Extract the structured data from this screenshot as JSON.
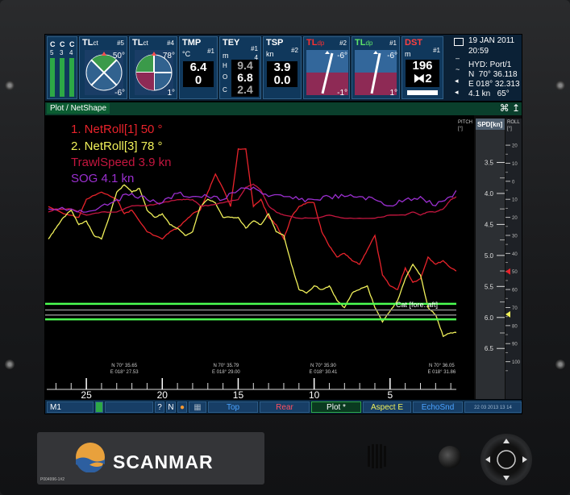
{
  "instruments": {
    "c_cols": [
      {
        "label": "C",
        "num": "5"
      },
      {
        "label": "C",
        "num": "3"
      },
      {
        "label": "C",
        "num": "4"
      }
    ],
    "tl1": {
      "title": "TL",
      "sub": "ct",
      "num": "#5",
      "val_top": "50°",
      "val_bot": "-6°"
    },
    "tl2": {
      "title": "TL",
      "sub": "ct",
      "num": "#4",
      "val_top": "78°",
      "val_bot": "1°"
    },
    "tmp": {
      "title": "TMP",
      "num": "#1",
      "unit": "°C",
      "val1": "6.4",
      "val2": "0"
    },
    "tey": {
      "title": "TEY",
      "num": "#1",
      "unit": "m",
      "sub_num": "4",
      "h": "9.4",
      "o": "6.8",
      "c": "2.4",
      "lh": "H",
      "lo": "O",
      "lc": "C"
    },
    "tsp": {
      "title": "TSP",
      "num": "#2",
      "unit": "kn",
      "val1": "3.9",
      "val2": "0.0"
    },
    "tldp1": {
      "title": "TL",
      "sub": "dp",
      "num": "#2",
      "val_top": "-6°",
      "val_bot": "-1°"
    },
    "tldp2": {
      "title": "TL",
      "sub": "dp",
      "num": "#1",
      "val_top": "-6°",
      "val_bot": "1°"
    },
    "dst": {
      "title": "DST",
      "num": "#1",
      "unit": "m",
      "val1": "196",
      "val2": "2"
    }
  },
  "info": {
    "date": "19 JAN 2011",
    "time": "20:59",
    "hyd": "HYD: Port/1",
    "lat_dir": "N",
    "lat": "70° 36.118",
    "lon_dir": "E",
    "lon": "018° 32.313",
    "spd": "4.1 kn",
    "hdg": "65°"
  },
  "plot": {
    "title": "Plot / NetShape",
    "tool_icons": [
      "⌘",
      "↥"
    ],
    "legend": [
      {
        "label": "1. NetRoll[1] 50 °",
        "color": "#e8232b"
      },
      {
        "label": "2. NetRoll[3] 78 °",
        "color": "#f0f05a"
      },
      {
        "label": "TrawlSpeed 3.9 kn",
        "color": "#c4163f"
      },
      {
        "label": "SOG 4.1 kn",
        "color": "#9b2fd0"
      }
    ],
    "cat_label": "Cat [fore..aft]",
    "pitch_label": "PITCH",
    "pitch_unit": "[°]",
    "spd_label": "SPD[kn]",
    "roll_label": "ROLL",
    "roll_unit": "[°]"
  },
  "chart_data": {
    "type": "line",
    "x_axis_ticks": [
      "25",
      "20",
      "15",
      "10",
      "5",
      "0"
    ],
    "x_ticks_values": [
      25,
      20,
      15,
      10,
      5,
      0
    ],
    "xlim": [
      27.5,
      0
    ],
    "positions": [
      {
        "lat": "N 70° 35.65",
        "lon": "E 018° 27.53",
        "x": 22.5
      },
      {
        "lat": "N 70° 35.79",
        "lon": "E 018° 29.00",
        "x": 15.8
      },
      {
        "lat": "N 70° 35.90",
        "lon": "E 018° 30.41",
        "x": 9.4
      },
      {
        "lat": "N 70° 36.05",
        "lon": "E 018° 31.86",
        "x": 1.6
      }
    ],
    "spd_scale": {
      "ticks": [
        "3.5",
        "4.0",
        "4.5",
        "5.0",
        "5.5",
        "6.0",
        "6.5"
      ],
      "values": [
        3.5,
        4.0,
        4.5,
        5.0,
        5.5,
        6.0,
        6.5
      ],
      "ylim": [
        3.0,
        6.9
      ]
    },
    "roll_scale": {
      "ticks": [
        "20",
        "10",
        "0",
        "10",
        "20",
        "30",
        "40",
        "50",
        "60",
        "70",
        "80",
        "90",
        "100"
      ],
      "values": [
        -20,
        -10,
        0,
        10,
        20,
        30,
        40,
        50,
        60,
        70,
        80,
        90,
        100
      ],
      "ylim": [
        -33,
        110
      ]
    },
    "series": [
      {
        "name": "NetRoll[1] 50 °",
        "color": "#e8232b",
        "scale": "roll",
        "x": [
          27.5,
          26.5,
          25.5,
          25,
          24,
          23,
          22.5,
          22,
          21,
          20,
          19.5,
          19,
          18.5,
          18,
          17.5,
          17,
          16.5,
          16,
          15.5,
          15,
          14.5,
          14,
          13.5,
          13,
          12.5,
          12,
          11.5,
          11,
          10.5,
          10,
          9.5,
          9,
          8.5,
          8,
          7.5,
          7,
          6.5,
          6,
          5.5,
          5,
          4.5,
          4,
          3.5,
          3,
          2.5,
          2,
          1.5,
          1,
          0.5,
          0.2
        ],
        "values": [
          14,
          18,
          20,
          10,
          6,
          10,
          18,
          16,
          28,
          32,
          28,
          26,
          22,
          18,
          16,
          6,
          -4,
          4,
          14,
          -18,
          -18,
          14,
          10,
          20,
          24,
          32,
          20,
          14,
          12,
          12,
          28,
          36,
          42,
          40,
          44,
          46,
          38,
          30,
          52,
          58,
          60,
          48,
          56,
          54,
          42,
          46,
          44,
          48,
          50,
          52
        ]
      },
      {
        "name": "NetRoll[3] 78 °",
        "color": "#f0f05a",
        "scale": "roll",
        "x": [
          27.5,
          27,
          26.5,
          26,
          25.5,
          25,
          24.5,
          24,
          23.5,
          23,
          22.5,
          22,
          21.5,
          21,
          20.5,
          20,
          19.5,
          19,
          18.5,
          18,
          17.5,
          17,
          16.5,
          16,
          15.5,
          15,
          14.5,
          14,
          13.5,
          13,
          12.5,
          12,
          11.5,
          11,
          10.5,
          10,
          9.5,
          9,
          8.5,
          8,
          7.5,
          7,
          6.5,
          6,
          5.5,
          5,
          4.5,
          4,
          3.5,
          3,
          2.5,
          2,
          1.5,
          1,
          0.5,
          0.2
        ],
        "values": [
          32,
          26,
          20,
          16,
          24,
          22,
          30,
          32,
          20,
          6,
          2,
          6,
          4,
          16,
          20,
          18,
          24,
          26,
          30,
          28,
          14,
          10,
          12,
          20,
          20,
          20,
          26,
          22,
          24,
          18,
          28,
          30,
          46,
          60,
          62,
          58,
          60,
          58,
          66,
          70,
          62,
          60,
          58,
          70,
          78,
          72,
          66,
          54,
          46,
          52,
          70,
          74,
          86,
          84,
          84,
          82
        ]
      },
      {
        "name": "TrawlSpeed 3.9 kn",
        "color": "#c4163f",
        "scale": "spd",
        "x": [
          27.5,
          27,
          26,
          25,
          24,
          23,
          22,
          21,
          20,
          19,
          18.5,
          18,
          17.5,
          17,
          16,
          15,
          14.5,
          14,
          13.5,
          13,
          12.5,
          12,
          11,
          10,
          9,
          8,
          7,
          6,
          5,
          4,
          3.5,
          3,
          2.5,
          2,
          1.5,
          1,
          0.6,
          0.2
        ],
        "values": [
          4.3,
          4.25,
          4.25,
          4.35,
          4.3,
          4.3,
          4.2,
          4.2,
          4.15,
          4.1,
          4.1,
          4.1,
          4.2,
          4.2,
          4.15,
          4.1,
          3.9,
          3.85,
          3.95,
          4.2,
          4.3,
          4.35,
          4.4,
          4.4,
          4.35,
          4.4,
          4.4,
          4.4,
          4.35,
          4.35,
          4.3,
          4.35,
          4.3,
          4.3,
          4.25,
          4.1,
          4.05,
          4.1
        ]
      },
      {
        "name": "SOG 4.1 kn",
        "color": "#9b2fd0",
        "scale": "spd",
        "x": [
          27.5,
          26,
          25,
          24,
          23,
          22,
          21,
          20,
          19,
          18,
          17,
          16,
          15,
          14,
          13,
          12,
          11,
          10,
          9,
          8,
          7,
          6,
          5,
          4,
          3,
          2,
          1,
          0.5,
          0.2
        ],
        "values": [
          4.25,
          4.25,
          4.3,
          4.2,
          4.1,
          4.0,
          4.1,
          4.15,
          4.0,
          4.05,
          4.05,
          4.1,
          3.95,
          3.9,
          4.05,
          4.05,
          4.1,
          4.1,
          4.05,
          4.05,
          4.05,
          4.1,
          4.2,
          4.1,
          4.05,
          4.2,
          4.05,
          3.95,
          3.95
        ]
      }
    ],
    "cat_lines": {
      "scale": "spd",
      "values": [
        5.78,
        5.88,
        5.96,
        6.03
      ]
    },
    "spd_marker": {
      "value": 5.95,
      "color": "#f0f05a"
    },
    "roll_marker": {
      "value": 50,
      "color": "#e8232b"
    }
  },
  "menu": {
    "m1": "M1",
    "q": "?",
    "n": "N",
    "top": "Top",
    "rear": "Rear",
    "plot": "Plot *",
    "aspect": "Aspect E",
    "echo": "EchoSnd",
    "ts": "22 03 2013 13 14"
  },
  "brand": {
    "name": "SCANMAR",
    "partno": "P004996-1#2"
  },
  "colors": {
    "accent": "#0b5d32",
    "panel": "#10385c"
  }
}
